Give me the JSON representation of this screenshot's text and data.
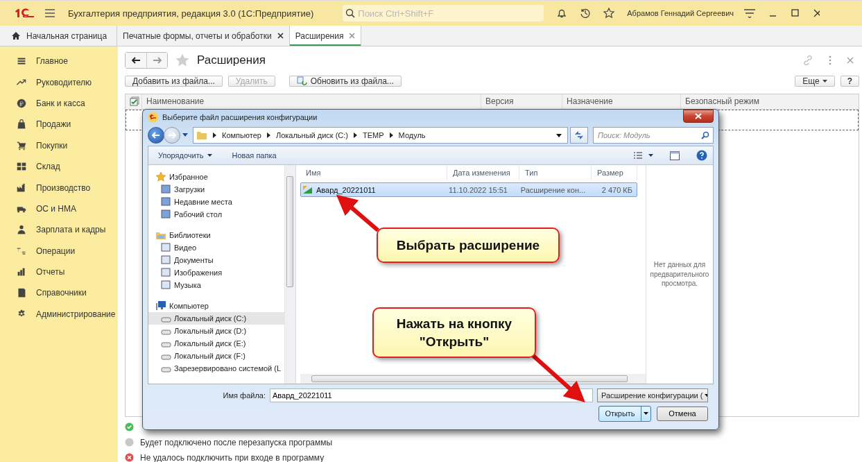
{
  "app": {
    "title": "Бухгалтерия предприятия, редакция 3.0  (1С:Предприятие)",
    "search": {
      "placeholder": "Поиск Ctrl+Shift+F"
    },
    "user": "Абрамов Геннадий Сергеевич"
  },
  "tabs": [
    {
      "label": "Начальная страница",
      "kind": "home",
      "selected": false
    },
    {
      "label": "Печатные формы, отчеты и обработки",
      "kind": "document",
      "selected": false
    },
    {
      "label": "Расширения",
      "kind": "document",
      "selected": true
    }
  ],
  "sidebar": {
    "items": [
      {
        "label": "Главное"
      },
      {
        "label": "Руководителю"
      },
      {
        "label": "Банк и касса"
      },
      {
        "label": "Продажи"
      },
      {
        "label": "Покупки"
      },
      {
        "label": "Склад"
      },
      {
        "label": "Производство"
      },
      {
        "label": "ОС и НМА"
      },
      {
        "label": "Зарплата и кадры"
      },
      {
        "label": "Операции"
      },
      {
        "label": "Отчеты"
      },
      {
        "label": "Справочники"
      },
      {
        "label": "Администрирование"
      }
    ]
  },
  "form": {
    "title": "Расширения",
    "buttons": [
      {
        "label": "Добавить из файла...",
        "disabled": false
      },
      {
        "label": "Удалить",
        "disabled": true
      },
      {
        "label": "Обновить из файла...",
        "disabled": false
      }
    ],
    "more": "Еще",
    "help": "?",
    "columns": [
      "Наименование",
      "Версия",
      "Назначение",
      "Безопасный режим"
    ],
    "legend": [
      {
        "kind": "ok"
      },
      {
        "kind": "pending",
        "label": "Будет подключено после перезапуска программы"
      },
      {
        "kind": "error",
        "label": "Не удалось подключить при входе в программу"
      }
    ]
  },
  "dialog": {
    "title": "Выберите файл расширения конфигурации",
    "path": [
      "Компьютер",
      "Локальный диск (C:)",
      "TEMP",
      "Модуль"
    ],
    "search": {
      "placeholder": "Поиск: Модуль"
    },
    "organize": "Упорядочить",
    "new_folder": "Новая папка",
    "nav": [
      {
        "label": "Избранное",
        "selected": false,
        "children": [
          {
            "label": "Загрузки",
            "selected": false
          },
          {
            "label": "Недавние места",
            "selected": false
          },
          {
            "label": "Рабочий стол",
            "selected": false
          }
        ]
      },
      {
        "label": "Библиотеки",
        "selected": false,
        "children": [
          {
            "label": "Видео",
            "selected": false
          },
          {
            "label": "Документы",
            "selected": false
          },
          {
            "label": "Изображения",
            "selected": false
          },
          {
            "label": "Музыка",
            "selected": false
          }
        ]
      },
      {
        "label": "Компьютер",
        "selected": false,
        "children": [
          {
            "label": "Локальный диск (C:)",
            "selected": true
          },
          {
            "label": "Локальный диск (D:)",
            "selected": false
          },
          {
            "label": "Локальный диск (E:)",
            "selected": false
          },
          {
            "label": "Локальный диск (F:)",
            "selected": false
          },
          {
            "label": "Зарезервировано системой (L",
            "selected": false
          }
        ]
      }
    ],
    "columns": [
      "Имя",
      "Дата изменения",
      "Тип",
      "Размер"
    ],
    "files": [
      {
        "name": "Авард_20221011",
        "modified": "11.10.2022 15:51",
        "type": "Расширение кон...",
        "size": "2 470 КБ",
        "selected": true
      }
    ],
    "preview": "Нет данных для предварительного просмотра.",
    "filename_label": "Имя файла:",
    "filename": "Авард_20221011",
    "filter": "Расширение конфигурации (",
    "open": "Открыть",
    "cancel": "Отмена"
  },
  "callouts": [
    {
      "text": "Выбрать расширение"
    },
    {
      "text": "Нажать на кнопку \"Открыть\""
    }
  ]
}
